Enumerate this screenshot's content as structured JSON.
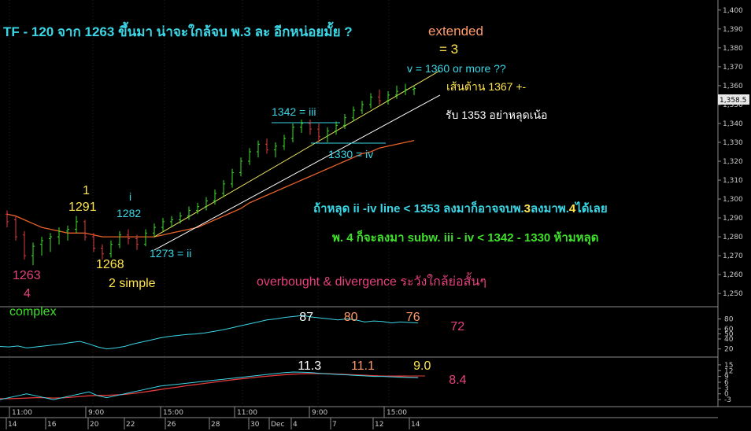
{
  "title": "TF - 120 จาก 1263 ขึ้นมา น่าจะใกล้จบ พ.3  ละ อีกหน่อยมั้ย ?",
  "chart_data": {
    "type": "candlestick",
    "price_axis": {
      "ylim": [
        1243,
        1402
      ],
      "ticks": [
        1250,
        1260,
        1270,
        1280,
        1290,
        1300,
        1310,
        1320,
        1330,
        1340,
        1350,
        1360,
        1370,
        1380,
        1390,
        1400
      ],
      "tick_labels": [
        "1,250",
        "1,260",
        "1,270",
        "1,280",
        "1,290",
        "1,300",
        "1,310",
        "1,320",
        "1,330",
        "1,340",
        "1,350",
        "1,360",
        "1,370",
        "1,380",
        "1,390",
        "1,400"
      ],
      "last_price_label": "1,358.5"
    },
    "ohlc": [
      [
        1292,
        1294,
        1285,
        1288
      ],
      [
        1289,
        1291,
        1278,
        1280
      ],
      [
        1281,
        1283,
        1268,
        1270
      ],
      [
        1270,
        1277,
        1265,
        1275
      ],
      [
        1276,
        1280,
        1270,
        1278
      ],
      [
        1279,
        1282,
        1272,
        1280
      ],
      [
        1280,
        1285,
        1276,
        1283
      ],
      [
        1283,
        1286,
        1278,
        1284
      ],
      [
        1284,
        1291,
        1282,
        1288
      ],
      [
        1288,
        1289,
        1278,
        1280
      ],
      [
        1280,
        1282,
        1272,
        1274
      ],
      [
        1274,
        1276,
        1268,
        1271
      ],
      [
        1271,
        1278,
        1269,
        1276
      ],
      [
        1276,
        1283,
        1274,
        1281
      ],
      [
        1281,
        1284,
        1276,
        1279
      ],
      [
        1279,
        1281,
        1273,
        1276
      ],
      [
        1276,
        1284,
        1275,
        1282
      ],
      [
        1282,
        1287,
        1280,
        1285
      ],
      [
        1285,
        1290,
        1283,
        1288
      ],
      [
        1288,
        1291,
        1285,
        1289
      ],
      [
        1289,
        1293,
        1287,
        1291
      ],
      [
        1291,
        1296,
        1289,
        1294
      ],
      [
        1294,
        1298,
        1292,
        1296
      ],
      [
        1296,
        1301,
        1294,
        1299
      ],
      [
        1299,
        1305,
        1297,
        1303
      ],
      [
        1303,
        1310,
        1301,
        1308
      ],
      [
        1308,
        1316,
        1306,
        1314
      ],
      [
        1314,
        1322,
        1312,
        1320
      ],
      [
        1320,
        1327,
        1318,
        1325
      ],
      [
        1325,
        1331,
        1322,
        1329
      ],
      [
        1329,
        1332,
        1324,
        1326
      ],
      [
        1326,
        1330,
        1322,
        1328
      ],
      [
        1328,
        1334,
        1326,
        1332
      ],
      [
        1332,
        1340,
        1330,
        1338
      ],
      [
        1338,
        1342,
        1335,
        1340
      ],
      [
        1340,
        1342,
        1334,
        1337
      ],
      [
        1337,
        1340,
        1330,
        1333
      ],
      [
        1333,
        1338,
        1330,
        1336
      ],
      [
        1336,
        1341,
        1334,
        1339
      ],
      [
        1339,
        1345,
        1337,
        1343
      ],
      [
        1343,
        1349,
        1341,
        1347
      ],
      [
        1347,
        1352,
        1345,
        1350
      ],
      [
        1350,
        1356,
        1348,
        1354
      ],
      [
        1354,
        1358,
        1350,
        1352
      ],
      [
        1352,
        1357,
        1350,
        1355
      ],
      [
        1355,
        1360,
        1353,
        1357
      ],
      [
        1357,
        1361,
        1355,
        1358
      ],
      [
        1358,
        1360,
        1355,
        1358.5
      ]
    ],
    "ema_line": [
      1292,
      1291,
      1289,
      1287,
      1285,
      1284,
      1283,
      1282,
      1282,
      1282,
      1281,
      1280,
      1280,
      1280,
      1280,
      1280,
      1280,
      1280,
      1281,
      1282,
      1283,
      1284,
      1285,
      1287,
      1289,
      1291,
      1293,
      1295,
      1298,
      1300,
      1302,
      1304,
      1306,
      1308,
      1310,
      1312,
      1314,
      1316,
      1318,
      1320,
      1322,
      1324,
      1325,
      1327,
      1328,
      1329,
      1330,
      1331
    ],
    "channel": {
      "upper": {
        "from": [
          17,
          1280
        ],
        "to": [
          50,
          1368
        ]
      },
      "lower": {
        "from": [
          17,
          1273
        ],
        "to": [
          50,
          1355
        ]
      }
    },
    "indicator1": {
      "ticks": [
        80,
        60,
        50,
        40,
        20
      ],
      "series_cyan": [
        25,
        24,
        26,
        22,
        24,
        26,
        28,
        30,
        33,
        35,
        30,
        24,
        20,
        22,
        25,
        30,
        34,
        38,
        42,
        45,
        47,
        49,
        50,
        52,
        55,
        58,
        62,
        66,
        70,
        74,
        78,
        80,
        83,
        85,
        87,
        84,
        82,
        80,
        78,
        80,
        78,
        74,
        76,
        75,
        72,
        74,
        73,
        72
      ],
      "labels": [
        {
          "text": "87",
          "i": 34,
          "color": "#ffffff"
        },
        {
          "text": "80",
          "i": 39,
          "color": "#ff9b6b"
        },
        {
          "text": "76",
          "i": 46,
          "color": "#ff9b6b"
        },
        {
          "text": "72",
          "i": 51,
          "color": "#e8417d"
        }
      ]
    },
    "indicator2": {
      "ticks": [
        15,
        12,
        9,
        6,
        3,
        0,
        -3
      ],
      "tick_labels": [
        "15",
        "12",
        "9",
        "6",
        "3",
        "0",
        "-3"
      ],
      "series_cyan": [
        -3,
        -2,
        -1,
        0,
        -1,
        -2,
        -3,
        -2,
        -1,
        0,
        1,
        -1,
        -2,
        -1,
        0,
        1,
        2,
        3,
        4,
        4.5,
        5,
        5.5,
        6,
        6.5,
        7,
        7.5,
        8,
        8.5,
        9,
        9.5,
        10,
        10.5,
        11,
        11.3,
        11.2,
        11,
        10.6,
        10.3,
        10,
        9.8,
        9.5,
        9.3,
        9,
        9,
        8.8,
        8.6,
        8.5,
        8.4
      ],
      "series_red": [
        -2.5,
        -2.5,
        -2.4,
        -2.2,
        -2,
        -2,
        -2.2,
        -2.1,
        -1.8,
        -1.4,
        -1,
        -0.8,
        -0.8,
        -0.6,
        -0.3,
        0.2,
        0.8,
        1.5,
        2.2,
        2.9,
        3.5,
        4.2,
        4.8,
        5.4,
        6,
        6.6,
        7.2,
        7.7,
        8.2,
        8.7,
        9.1,
        9.5,
        9.9,
        10.2,
        10.4,
        10.5,
        10.5,
        10.4,
        10.2,
        10,
        9.8,
        9.6,
        9.4,
        9.2,
        9,
        8.8,
        8.6,
        8.5
      ],
      "labels": [
        {
          "text": "11.3",
          "i": 34,
          "color": "#ffffff"
        },
        {
          "text": "11.1",
          "i": 40,
          "color": "#ff9b6b"
        },
        {
          "text": "9.0",
          "i": 47,
          "color": "#ffe54a"
        },
        {
          "text": "8.4",
          "i": 51,
          "color": "#e8417d"
        }
      ]
    },
    "time_labels": [
      "11:00",
      "9:00",
      "15:00",
      "11:00",
      "9:00",
      "15:00"
    ],
    "date_labels": [
      "14",
      "16",
      "20",
      "22",
      "26",
      "28",
      "30",
      "Dec",
      "4",
      "7",
      "12",
      "14"
    ]
  },
  "annotations": {
    "extended": "extended",
    "eq3": "= 3",
    "v_target": "v = 1360 or more ??",
    "resistance": "เส้นต้าน 1367 +-",
    "support": "รับ 1353  อย่าหลุดเน้อ",
    "wave_iii": "1342 = iii",
    "wave_iv": "1330 = iv",
    "wave_i_label": "i",
    "wave_i_value": "1282",
    "wave_ii": "1273 = ii",
    "wave1_label": "1",
    "wave1_value": "1291",
    "wave2_value": "1268",
    "wave2_note": "2  simple",
    "wave4_value": "1263",
    "wave4_label": "4",
    "wave4_note": "complex",
    "note_ii_iv_a": "ถ้าหลุด ii -iv line < 1353 ลงมาก็อาจจบพ.",
    "note_ii_iv_b": "3",
    "note_ii_iv_c": "ลงมาพ.",
    "note_ii_iv_d": "4",
    "note_ii_iv_e": "ได้เลย",
    "note_w4": "พ. 4  ก็จะลงมา subw. iii - iv < 1342 - 1330 ห้ามหลุด",
    "note_ob": "overbought & divergence ระวังใกล้ย่อสั้นๆ"
  },
  "colors": {
    "cyan": "#3ad6e6",
    "yellow": "#ffe54a",
    "orange": "#ff9b6b",
    "green": "#3ee02a",
    "pink": "#e8417d",
    "ema": "#e8622a",
    "candle_up": "#3ee02a",
    "candle_down": "#e23b3b"
  }
}
